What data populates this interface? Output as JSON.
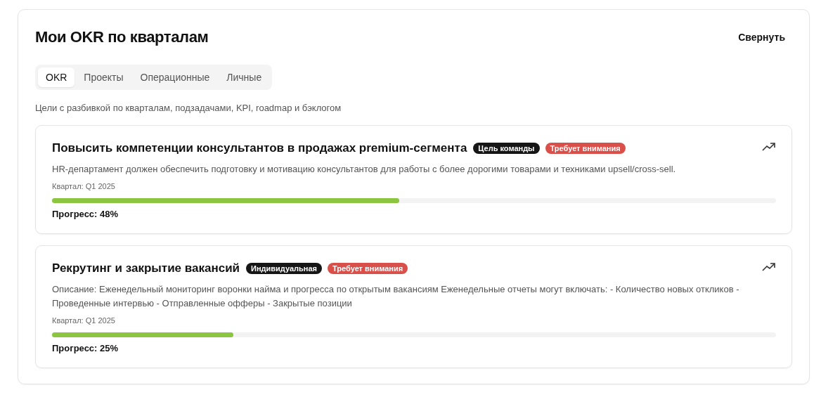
{
  "header": {
    "title": "Мои OKR по кварталам",
    "collapse_button": "Свернуть"
  },
  "tabs": [
    {
      "label": "OKR",
      "selected": true
    },
    {
      "label": "Проекты",
      "selected": false
    },
    {
      "label": "Операционные",
      "selected": false
    },
    {
      "label": "Личные",
      "selected": false
    }
  ],
  "subtitle": "Цели с разбивкой по кварталам, подзадачами, KPI, roadmap и бэклогом",
  "goals": [
    {
      "title": "Повысить компетенции консультантов в продажах premium-сегмента",
      "badges": [
        {
          "text": "Цель команды",
          "kind": "type"
        },
        {
          "text": "Требует внимания",
          "kind": "alert"
        }
      ],
      "description": "HR-департамент должен обеспечить подготовку и мотивацию консультантов для работы с более дорогими товарами и техниками upsell/cross-sell.",
      "quarter": "Квартал: Q1 2025",
      "level": 0.48,
      "progress": "Прогресс: 48%"
    },
    {
      "title": "Рекрутинг и закрытие вакансий",
      "badges": [
        {
          "text": "Индивидуальная",
          "kind": "type"
        },
        {
          "text": "Требует внимания",
          "kind": "alert"
        }
      ],
      "description": "Описание: Еженедельный мониторинг воронки найма и прогресса по открытым вакансиям Еженедельные отчеты могут включать: - Количество новых откликов - Проведенные интервью - Отправленные офферы - Закрытые позиции",
      "quarter": "Квартал: Q1 2025",
      "level": 0.25,
      "progress": "Прогресс: 25%"
    }
  ]
}
